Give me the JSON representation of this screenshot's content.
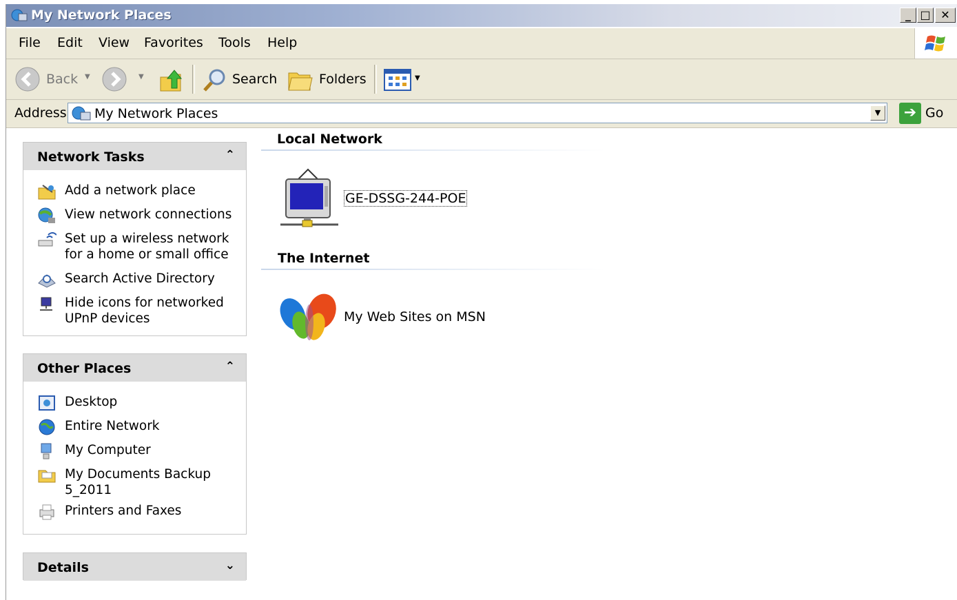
{
  "window": {
    "title": "My Network Places"
  },
  "menu": [
    "File",
    "Edit",
    "View",
    "Favorites",
    "Tools",
    "Help"
  ],
  "toolbar": {
    "back_label": "Back",
    "search_label": "Search",
    "folders_label": "Folders"
  },
  "address": {
    "label": "Address",
    "value": "My Network Places",
    "go_label": "Go"
  },
  "network_tasks": {
    "title": "Network Tasks",
    "items": [
      {
        "label": "Add a network place",
        "icon": "add-network-place-icon"
      },
      {
        "label": "View network connections",
        "icon": "network-connections-icon"
      },
      {
        "label": "Set up a wireless network",
        "label2": "for a home or small office",
        "icon": "wireless-network-icon"
      },
      {
        "label": "Search Active Directory",
        "icon": "search-directory-icon"
      },
      {
        "label": "Hide icons for networked",
        "label2": "UPnP devices",
        "icon": "upnp-device-icon"
      }
    ]
  },
  "other_places": {
    "title": "Other Places",
    "items": [
      {
        "label": "Desktop",
        "icon": "desktop-icon"
      },
      {
        "label": "Entire Network",
        "icon": "globe-icon"
      },
      {
        "label": "My Computer",
        "icon": "computer-icon"
      },
      {
        "label": "My Documents Backup",
        "label2": "5_2011",
        "icon": "folder-icon"
      },
      {
        "label": "Printers and Faxes",
        "icon": "printer-icon"
      }
    ]
  },
  "details": {
    "title": "Details"
  },
  "content": {
    "local_network": {
      "title": "Local Network",
      "item": "GE-DSSG-244-POE"
    },
    "internet": {
      "title": "The Internet",
      "item": "My Web Sites on MSN"
    }
  }
}
